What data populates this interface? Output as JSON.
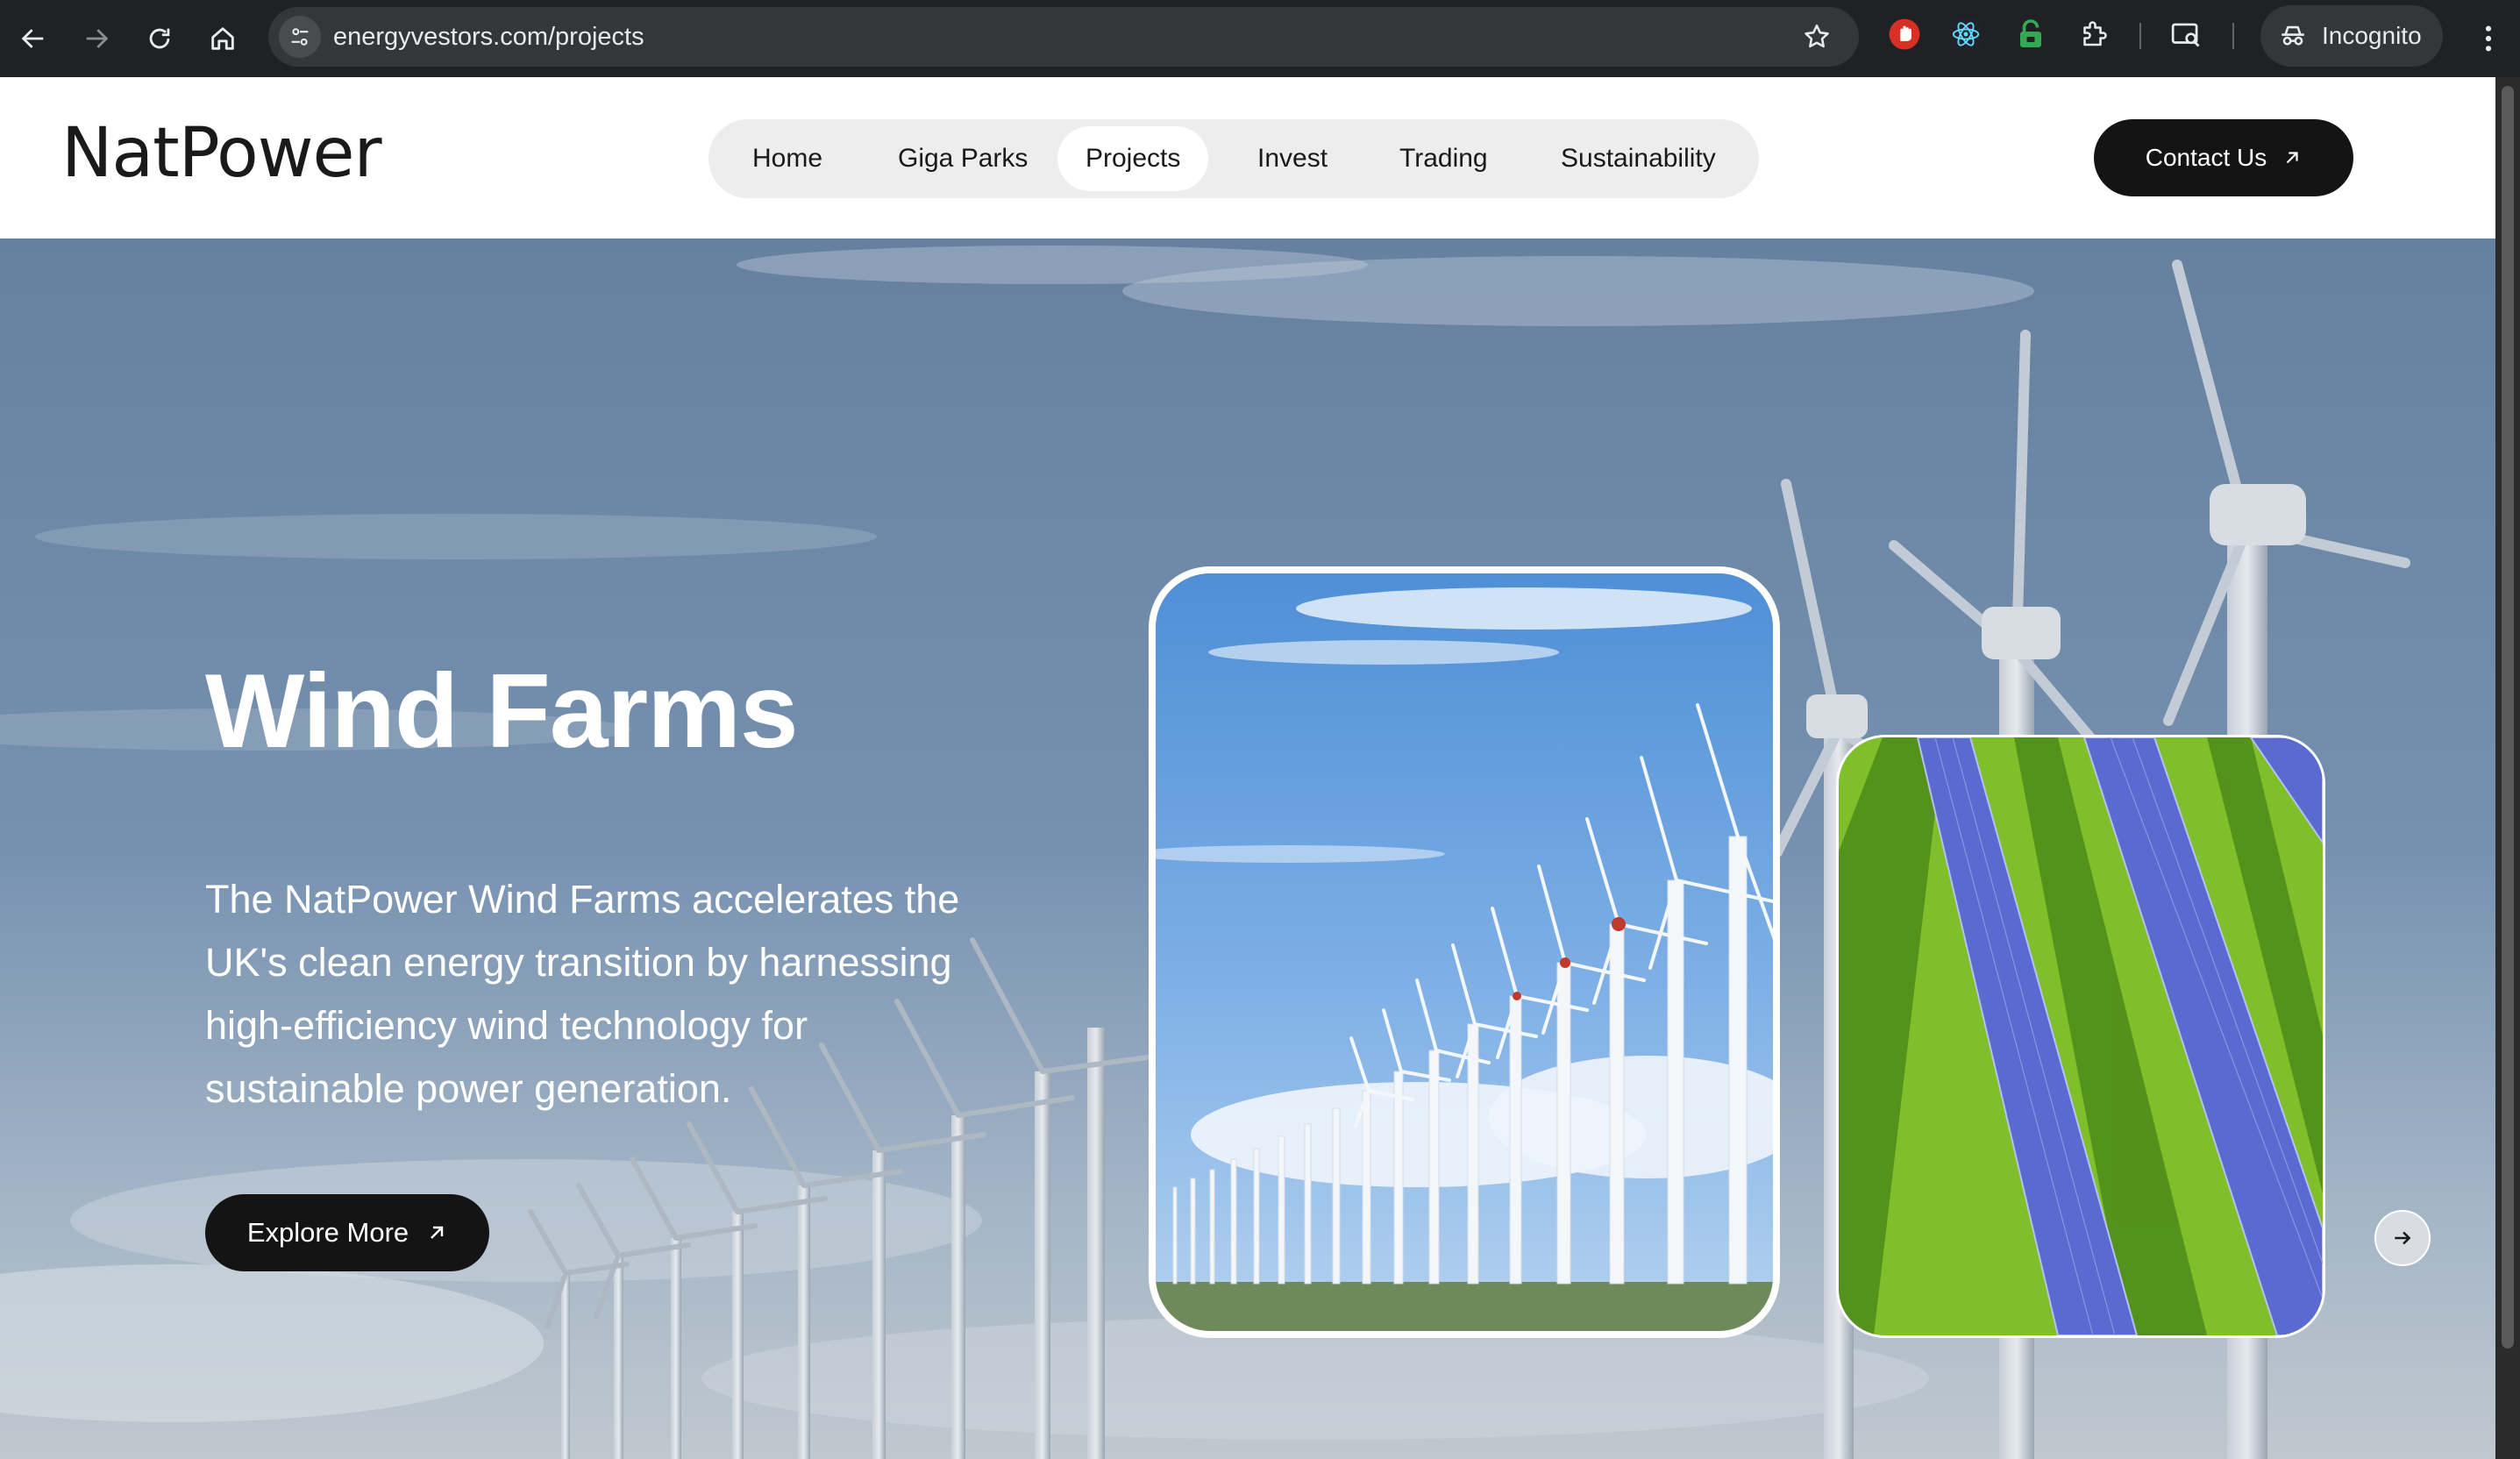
{
  "browser": {
    "url": "energyvestors.com/projects",
    "incognito_label": "Incognito",
    "icons": [
      "back-arrow-icon",
      "forward-arrow-icon",
      "reload-icon",
      "home-icon",
      "site-settings-icon",
      "bookmark-star-icon",
      "extension-red-icon",
      "extension-react-icon",
      "extension-green-lock-icon",
      "extensions-puzzle-icon",
      "tab-search-icon",
      "incognito-icon",
      "kebab-menu-icon"
    ]
  },
  "header": {
    "logo": "NatPower",
    "nav": [
      {
        "label": "Home",
        "active": false
      },
      {
        "label": "Giga Parks",
        "active": false
      },
      {
        "label": "Projects",
        "active": true
      },
      {
        "label": "Invest",
        "active": false
      },
      {
        "label": "Trading",
        "active": false
      },
      {
        "label": "Sustainability",
        "active": false
      }
    ],
    "contact_label": "Contact Us"
  },
  "hero": {
    "title": "Wind Farms",
    "description": "The NatPower Wind Farms accelerates the UK's clean energy transition by harnessing high-efficiency wind technology for sustainable power generation.",
    "cta_label": "Explore More",
    "cards": [
      {
        "name": "wind-farm-image",
        "active": true
      },
      {
        "name": "solar-farm-image",
        "active": false
      }
    ]
  },
  "colors": {
    "chrome_bg": "#202124",
    "omnibox_bg": "#35363a",
    "button_dark": "#141414",
    "nav_pill": "#ededed",
    "sky": "#6f8dae",
    "grass": "#7fbf2a",
    "panel_blue": "#5566c8"
  }
}
